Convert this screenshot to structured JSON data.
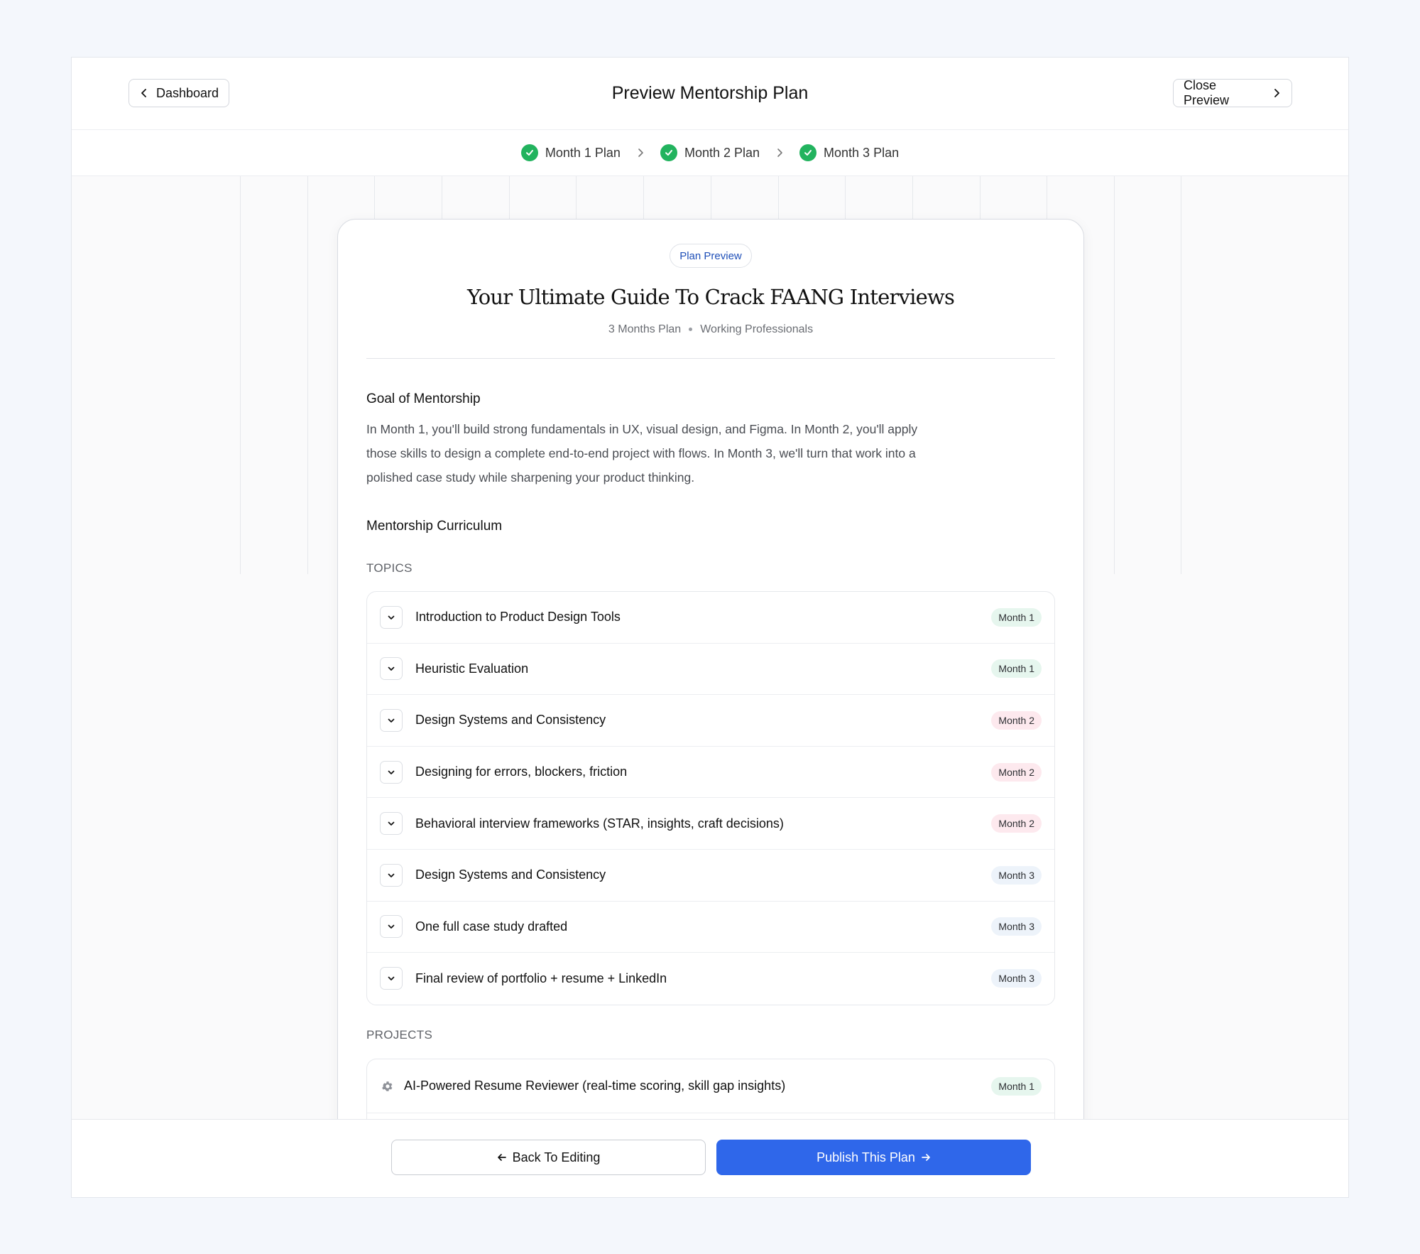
{
  "header": {
    "dashboard_label": "Dashboard",
    "title": "Preview Mentorship Plan",
    "close_label": "Close Preview"
  },
  "steps": [
    {
      "label": "Month 1 Plan",
      "status": "complete"
    },
    {
      "label": "Month 2 Plan",
      "status": "complete"
    },
    {
      "label": "Month 3 Plan",
      "status": "complete"
    }
  ],
  "plan": {
    "pill": "Plan Preview",
    "title": "Your Ultimate Guide To Crack FAANG Interviews",
    "duration": "3 Months Plan",
    "audience": "Working Professionals",
    "goal_heading": "Goal of Mentorship",
    "goal_text": "In Month 1, you'll build strong fundamentals in UX, visual design, and Figma. In Month 2, you'll apply those skills to design a complete end-to-end project with flows. In Month 3, we'll turn that work into a polished case study while sharpening your product thinking.",
    "curriculum_heading": "Mentorship Curriculum",
    "topics_label": "TOPICS",
    "topics": [
      {
        "title": "Introduction to Product Design Tools",
        "month": "Month 1"
      },
      {
        "title": "Heuristic Evaluation",
        "month": "Month 1"
      },
      {
        "title": "Design Systems and Consistency",
        "month": "Month 2"
      },
      {
        "title": "Designing for errors, blockers, friction",
        "month": "Month 2"
      },
      {
        "title": "Behavioral interview frameworks (STAR, insights, craft decisions)",
        "month": "Month 2"
      },
      {
        "title": "Design Systems and Consistency",
        "month": "Month 3"
      },
      {
        "title": "One full case study drafted",
        "month": "Month 3"
      },
      {
        "title": "Final review of portfolio + resume + LinkedIn",
        "month": "Month 3"
      }
    ],
    "projects_label": "PROJECTS",
    "projects": [
      {
        "title": "AI-Powered Resume Reviewer (real-time scoring, skill gap insights)",
        "month": "Month 1"
      }
    ]
  },
  "footer": {
    "back_label": "Back To Editing",
    "publish_label": "Publish This Plan"
  },
  "colors": {
    "accent": "#2f67ea",
    "success": "#22b35e",
    "month1_badge": "#e6f6ee",
    "month2_badge": "#fde9ee",
    "month3_badge": "#edf3fa"
  }
}
